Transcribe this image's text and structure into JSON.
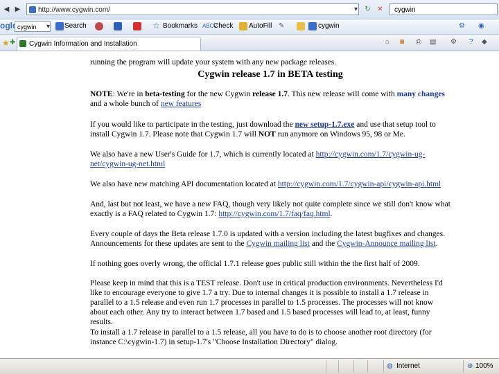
{
  "address_bar": {
    "url": "http://www.cygwin.com/",
    "search_value": "cygwin"
  },
  "google_toolbar": {
    "logo": "ogle",
    "search_value": "cygwin",
    "search_label": "Search",
    "bookmarks_label": "Bookmarks",
    "check_label": "Check",
    "autofill_label": "AutoFill",
    "cygwin_label": "cygwin"
  },
  "tabs": {
    "active_title": "Cygwin Information and Installation"
  },
  "page": {
    "top_partial": "running the program will update your system with any new package releases.",
    "heading": "Cygwin release 1.7 in BETA testing",
    "note_label": "NOTE",
    "p1_a": ": We're in ",
    "p1_b": "beta-testing",
    "p1_c": " for the new Cygwin ",
    "p1_d": "release 1.7",
    "p1_e": ". This new release will come with ",
    "p1_f": "many changes",
    "p1_g": " and a whole bunch of ",
    "p1_link": "new features",
    "p2_a": "If you would like to participate in the testing, just download the ",
    "p2_link": "new setup-1.7.exe",
    "p2_b": " and use that setup tool to install Cygwin 1.7. Please note that Cygwin 1.7 will ",
    "p2_not": "NOT",
    "p2_c": " run anymore on Windows 95, 98 or Me.",
    "p3_a": "We also have a new User's Guide for 1.7, which is currently located at ",
    "p3_link": "http://cygwin.com/1.7/cygwin-ug-net/cygwin-ug-net.html",
    "p4_a": "We also have new matching API documentation located at ",
    "p4_link": "http://cygwin.com/1.7/cygwin-api/cygwin-api.html",
    "p5_a": "And, last but not least, we have a new FAQ, though very likely not quite complete since we still don't know what exactly is a FAQ related to Cygwin 1.7: ",
    "p5_link": "http://cygwin.com/1.7/faq/faq.html",
    "p6_a": "Every couple of days the Beta release 1.7.0 is updated with a version including the latest bugfixes and changes. Announcements for these updates are sent to the ",
    "p6_link1": "Cygwin mailing list",
    "p6_b": " and the ",
    "p6_link2": "Cygwin-Announce mailing list",
    "p7": "If nothing goes overly wrong, the official 1.7.1 release goes public still within the the first half of 2009.",
    "p8": "Please keep in mind that this is a TEST release. Don't use in critical production environments. Nevertheless I'd like to encourage everyone to give 1.7 a try. Due to internal changes it is possible to install a 1.7 release in parallel to a 1.5 release and even run 1.7 processes in parallel to 1.5 processes. The processes will not know about each other. Any try to interact between 1.7 based and 1.5 based processes will lead to, at least, funny results.",
    "p9": "To install a 1.7 release in parallel to a 1.5 release, all you have to do is to choose another root directory (for instance C:\\cygwin-1.7) in setup-1.7's \"Choose Installation Directory\" dialog."
  },
  "status_bar": {
    "zone": "Internet",
    "zoom": "100%"
  }
}
